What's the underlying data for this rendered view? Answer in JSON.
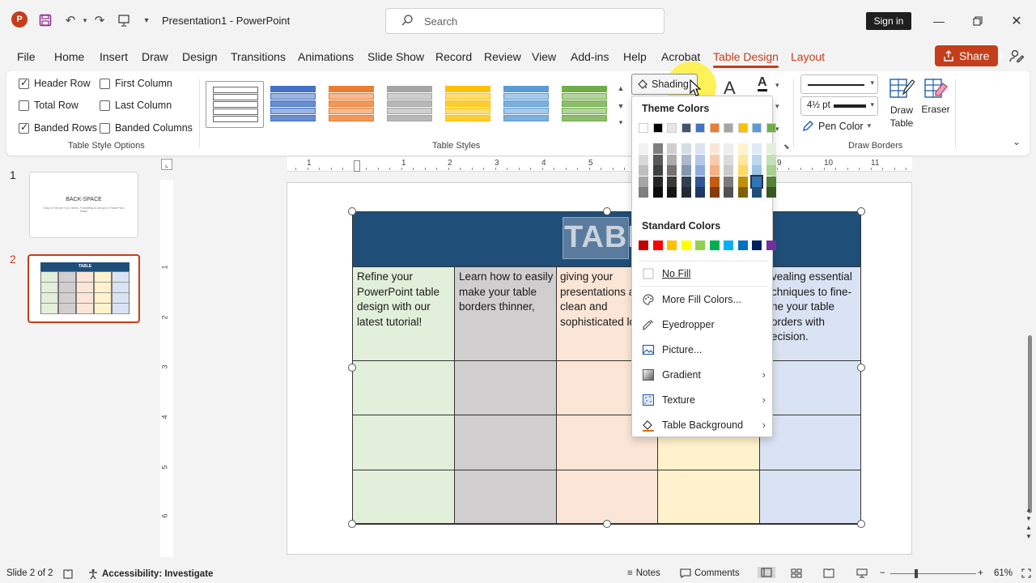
{
  "titlebar": {
    "app_name": "PowerPoint",
    "doc_title": "Presentation1  -  PowerPoint",
    "search_placeholder": "Search",
    "signin_label": "Sign in"
  },
  "menu": {
    "tabs": [
      "File",
      "Home",
      "Insert",
      "Draw",
      "Design",
      "Transitions",
      "Animations",
      "Slide Show",
      "Record",
      "Review",
      "View",
      "Add-ins",
      "Help",
      "Acrobat",
      "Table Design",
      "Layout"
    ],
    "active_tab": "Table Design",
    "share_label": "Share"
  },
  "ribbon": {
    "table_style_options": {
      "label": "Table Style Options",
      "options": [
        {
          "label": "Header Row",
          "checked": true
        },
        {
          "label": "First Column",
          "checked": false
        },
        {
          "label": "Total Row",
          "checked": false
        },
        {
          "label": "Last Column",
          "checked": false
        },
        {
          "label": "Banded Rows",
          "checked": true
        },
        {
          "label": "Banded Columns",
          "checked": false
        }
      ]
    },
    "table_styles": {
      "label": "Table Styles",
      "swatches": [
        "#ffffff",
        "#4472c4",
        "#ed7d31",
        "#a5a5a5",
        "#ffc000",
        "#5b9bd5",
        "#70ad47"
      ]
    },
    "shading_label": "Shading",
    "pen_weight": "4½ pt",
    "pen_color_label": "Pen Color",
    "draw_table_label": "Draw Table",
    "eraser_label": "Eraser",
    "draw_borders_label": "Draw Borders"
  },
  "shading_menu": {
    "theme_colors_label": "Theme Colors",
    "theme_colors": [
      "#ffffff",
      "#000000",
      "#e7e6e6",
      "#44546a",
      "#4472c4",
      "#ed7d31",
      "#a5a5a5",
      "#ffc000",
      "#5b9bd5",
      "#70ad47"
    ],
    "theme_shades": [
      [
        "#f2f2f2",
        "#7f7f7f",
        "#d0cece",
        "#d6dce4",
        "#d9e2f3",
        "#fbe5d6",
        "#ededed",
        "#fff2cc",
        "#deebf7",
        "#e2f0d9"
      ],
      [
        "#d9d9d9",
        "#595959",
        "#aeabab",
        "#adb9ca",
        "#b4c7e7",
        "#f8cbad",
        "#dbdbdb",
        "#ffe699",
        "#bdd7ee",
        "#c5e0b4"
      ],
      [
        "#bfbfbf",
        "#404040",
        "#757171",
        "#8497b0",
        "#8faadc",
        "#f4b183",
        "#c9c9c9",
        "#ffd966",
        "#9dc3e6",
        "#a9d18e"
      ],
      [
        "#a6a6a6",
        "#262626",
        "#3b3838",
        "#333f50",
        "#2f5597",
        "#c55a11",
        "#7b7b7b",
        "#bf9000",
        "#2e75b6",
        "#548235"
      ],
      [
        "#7f7f7f",
        "#0d0d0d",
        "#171616",
        "#222a35",
        "#203864",
        "#843c0c",
        "#525252",
        "#7f6000",
        "#1f4e79",
        "#385723"
      ]
    ],
    "standard_colors_label": "Standard Colors",
    "standard_colors": [
      "#c00000",
      "#ff0000",
      "#ffc000",
      "#ffff00",
      "#92d050",
      "#00b050",
      "#00b0f0",
      "#0070c0",
      "#002060",
      "#7030a0"
    ],
    "items": [
      {
        "label": "No Fill",
        "icon": "no-fill-icon",
        "submenu": false
      },
      {
        "label": "More Fill Colors...",
        "icon": "palette-icon",
        "submenu": false
      },
      {
        "label": "Eyedropper",
        "icon": "eyedropper-icon",
        "submenu": false
      },
      {
        "label": "Picture...",
        "icon": "picture-icon",
        "submenu": false
      },
      {
        "label": "Gradient",
        "icon": "gradient-icon",
        "submenu": true
      },
      {
        "label": "Texture",
        "icon": "texture-icon",
        "submenu": true
      },
      {
        "label": "Table Background",
        "icon": "paint-bucket-icon",
        "submenu": true
      }
    ]
  },
  "slides": [
    {
      "number": "1",
      "title": "BACK-SPACE",
      "subtitle": "Easy to Elevate Your Tables: Formatting & Design in PowerPoint Slides"
    },
    {
      "number": "2",
      "title": "TABLE"
    }
  ],
  "table": {
    "header_text": "TABL",
    "header_color": "#1f4e79",
    "column_colors": [
      "#e2efda",
      "#d0cece",
      "#fbe5d6",
      "#fff2cc",
      "#dae3f3"
    ],
    "row1": [
      "Refine your PowerPoint table design with our latest tutorial!",
      "Learn how to easily make your table borders thinner,",
      "giving your presentations a clean and sophisticated lo",
      "",
      "vealing essential chniques to fine- ne your table orders with ecision."
    ]
  },
  "ruler": {
    "h_ticks": [
      "1",
      "1",
      "2",
      "3",
      "4",
      "5",
      "9",
      "10",
      "11"
    ],
    "v_ticks": [
      "1",
      "2",
      "3",
      "4",
      "5",
      "6"
    ]
  },
  "statusbar": {
    "slide_info": "Slide 2 of 2",
    "accessibility": "Accessibility: Investigate",
    "notes": "Notes",
    "comments": "Comments",
    "zoom": "61%"
  }
}
